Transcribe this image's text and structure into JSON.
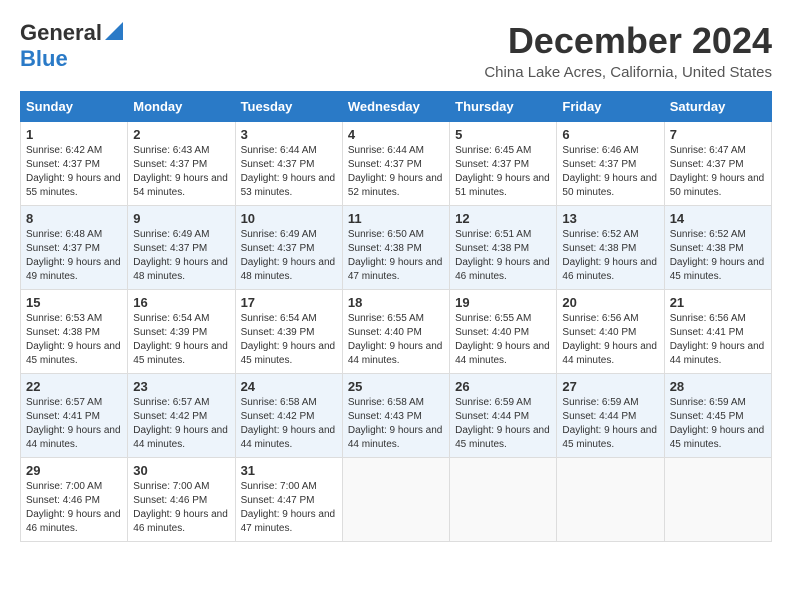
{
  "header": {
    "logo_line1": "General",
    "logo_line2": "Blue",
    "month": "December 2024",
    "location": "China Lake Acres, California, United States"
  },
  "days_of_week": [
    "Sunday",
    "Monday",
    "Tuesday",
    "Wednesday",
    "Thursday",
    "Friday",
    "Saturday"
  ],
  "weeks": [
    [
      {
        "day": "1",
        "sunrise": "6:42 AM",
        "sunset": "4:37 PM",
        "daylight": "9 hours and 55 minutes."
      },
      {
        "day": "2",
        "sunrise": "6:43 AM",
        "sunset": "4:37 PM",
        "daylight": "9 hours and 54 minutes."
      },
      {
        "day": "3",
        "sunrise": "6:44 AM",
        "sunset": "4:37 PM",
        "daylight": "9 hours and 53 minutes."
      },
      {
        "day": "4",
        "sunrise": "6:44 AM",
        "sunset": "4:37 PM",
        "daylight": "9 hours and 52 minutes."
      },
      {
        "day": "5",
        "sunrise": "6:45 AM",
        "sunset": "4:37 PM",
        "daylight": "9 hours and 51 minutes."
      },
      {
        "day": "6",
        "sunrise": "6:46 AM",
        "sunset": "4:37 PM",
        "daylight": "9 hours and 50 minutes."
      },
      {
        "day": "7",
        "sunrise": "6:47 AM",
        "sunset": "4:37 PM",
        "daylight": "9 hours and 50 minutes."
      }
    ],
    [
      {
        "day": "8",
        "sunrise": "6:48 AM",
        "sunset": "4:37 PM",
        "daylight": "9 hours and 49 minutes."
      },
      {
        "day": "9",
        "sunrise": "6:49 AM",
        "sunset": "4:37 PM",
        "daylight": "9 hours and 48 minutes."
      },
      {
        "day": "10",
        "sunrise": "6:49 AM",
        "sunset": "4:37 PM",
        "daylight": "9 hours and 48 minutes."
      },
      {
        "day": "11",
        "sunrise": "6:50 AM",
        "sunset": "4:38 PM",
        "daylight": "9 hours and 47 minutes."
      },
      {
        "day": "12",
        "sunrise": "6:51 AM",
        "sunset": "4:38 PM",
        "daylight": "9 hours and 46 minutes."
      },
      {
        "day": "13",
        "sunrise": "6:52 AM",
        "sunset": "4:38 PM",
        "daylight": "9 hours and 46 minutes."
      },
      {
        "day": "14",
        "sunrise": "6:52 AM",
        "sunset": "4:38 PM",
        "daylight": "9 hours and 45 minutes."
      }
    ],
    [
      {
        "day": "15",
        "sunrise": "6:53 AM",
        "sunset": "4:38 PM",
        "daylight": "9 hours and 45 minutes."
      },
      {
        "day": "16",
        "sunrise": "6:54 AM",
        "sunset": "4:39 PM",
        "daylight": "9 hours and 45 minutes."
      },
      {
        "day": "17",
        "sunrise": "6:54 AM",
        "sunset": "4:39 PM",
        "daylight": "9 hours and 45 minutes."
      },
      {
        "day": "18",
        "sunrise": "6:55 AM",
        "sunset": "4:40 PM",
        "daylight": "9 hours and 44 minutes."
      },
      {
        "day": "19",
        "sunrise": "6:55 AM",
        "sunset": "4:40 PM",
        "daylight": "9 hours and 44 minutes."
      },
      {
        "day": "20",
        "sunrise": "6:56 AM",
        "sunset": "4:40 PM",
        "daylight": "9 hours and 44 minutes."
      },
      {
        "day": "21",
        "sunrise": "6:56 AM",
        "sunset": "4:41 PM",
        "daylight": "9 hours and 44 minutes."
      }
    ],
    [
      {
        "day": "22",
        "sunrise": "6:57 AM",
        "sunset": "4:41 PM",
        "daylight": "9 hours and 44 minutes."
      },
      {
        "day": "23",
        "sunrise": "6:57 AM",
        "sunset": "4:42 PM",
        "daylight": "9 hours and 44 minutes."
      },
      {
        "day": "24",
        "sunrise": "6:58 AM",
        "sunset": "4:42 PM",
        "daylight": "9 hours and 44 minutes."
      },
      {
        "day": "25",
        "sunrise": "6:58 AM",
        "sunset": "4:43 PM",
        "daylight": "9 hours and 44 minutes."
      },
      {
        "day": "26",
        "sunrise": "6:59 AM",
        "sunset": "4:44 PM",
        "daylight": "9 hours and 45 minutes."
      },
      {
        "day": "27",
        "sunrise": "6:59 AM",
        "sunset": "4:44 PM",
        "daylight": "9 hours and 45 minutes."
      },
      {
        "day": "28",
        "sunrise": "6:59 AM",
        "sunset": "4:45 PM",
        "daylight": "9 hours and 45 minutes."
      }
    ],
    [
      {
        "day": "29",
        "sunrise": "7:00 AM",
        "sunset": "4:46 PM",
        "daylight": "9 hours and 46 minutes."
      },
      {
        "day": "30",
        "sunrise": "7:00 AM",
        "sunset": "4:46 PM",
        "daylight": "9 hours and 46 minutes."
      },
      {
        "day": "31",
        "sunrise": "7:00 AM",
        "sunset": "4:47 PM",
        "daylight": "9 hours and 47 minutes."
      },
      {
        "day": "",
        "sunrise": "",
        "sunset": "",
        "daylight": ""
      },
      {
        "day": "",
        "sunrise": "",
        "sunset": "",
        "daylight": ""
      },
      {
        "day": "",
        "sunrise": "",
        "sunset": "",
        "daylight": ""
      },
      {
        "day": "",
        "sunrise": "",
        "sunset": "",
        "daylight": ""
      }
    ]
  ],
  "labels": {
    "sunrise": "Sunrise:",
    "sunset": "Sunset:",
    "daylight": "Daylight:"
  }
}
